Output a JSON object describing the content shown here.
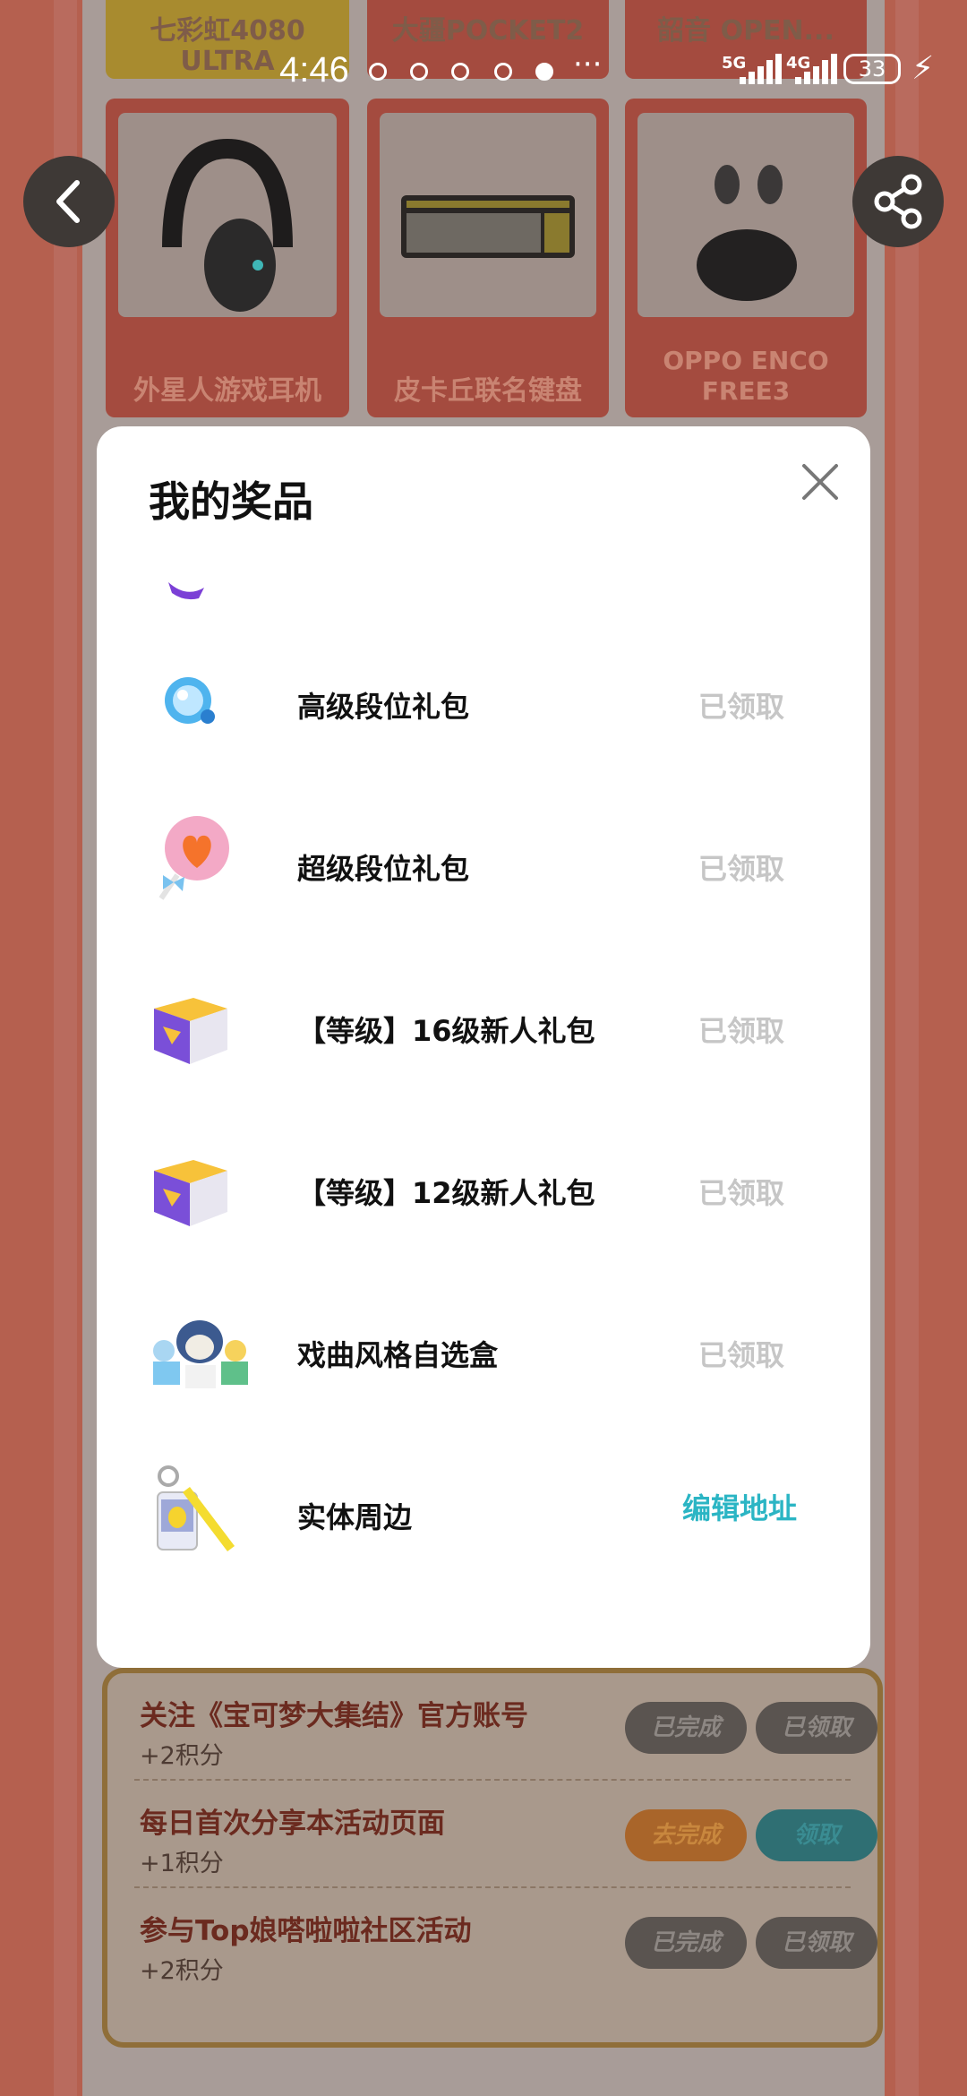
{
  "status_bar": {
    "time": "4:46",
    "more": "···",
    "net1": "5G",
    "net2": "4G",
    "battery": "33"
  },
  "background": {
    "top_tiles": [
      "七彩虹4080 ULTRA",
      "大疆POCKET2",
      "韶音 OPEN..."
    ],
    "products": [
      "外星人游戏耳机",
      "皮卡丘联名键盘",
      "OPPO ENCO FREE3"
    ],
    "tasks": [
      {
        "title": "关注《宝可梦大集结》官方账号",
        "points": "+2积分",
        "btn1": "已完成",
        "btn2": "已领取",
        "btn1_style": "grey",
        "btn2_style": "grey"
      },
      {
        "title": "每日首次分享本活动页面",
        "points": "+1积分",
        "btn1": "去完成",
        "btn2": "领取",
        "btn1_style": "orange",
        "btn2_style": "teal"
      },
      {
        "title": "参与Top娘嗒啦啦社区活动",
        "points": "+2积分",
        "btn1": "已完成",
        "btn2": "已领取",
        "btn1_style": "grey",
        "btn2_style": "grey"
      }
    ]
  },
  "dialog": {
    "title": "我的奖品",
    "prizes": [
      {
        "name": "高级段位礼包",
        "status": "已领取",
        "icon": "blue-orb-icon"
      },
      {
        "name": "超级段位礼包",
        "status": "已领取",
        "icon": "heart-lollipop-icon"
      },
      {
        "name": "【等级】16级新人礼包",
        "status": "已领取",
        "icon": "purple-gift-box-icon"
      },
      {
        "name": "【等级】12级新人礼包",
        "status": "已领取",
        "icon": "purple-gift-box-icon"
      },
      {
        "name": "戏曲风格自选盒",
        "status": "已领取",
        "icon": "pokemon-figures-icon"
      },
      {
        "name": "实体周边",
        "status": "编辑地址",
        "icon": "pikachu-keychain-icon"
      }
    ]
  },
  "colors": {
    "claimed": "#c6c6c6",
    "action": "#2bb5c4",
    "overlay_bg": "#6b5d57"
  }
}
